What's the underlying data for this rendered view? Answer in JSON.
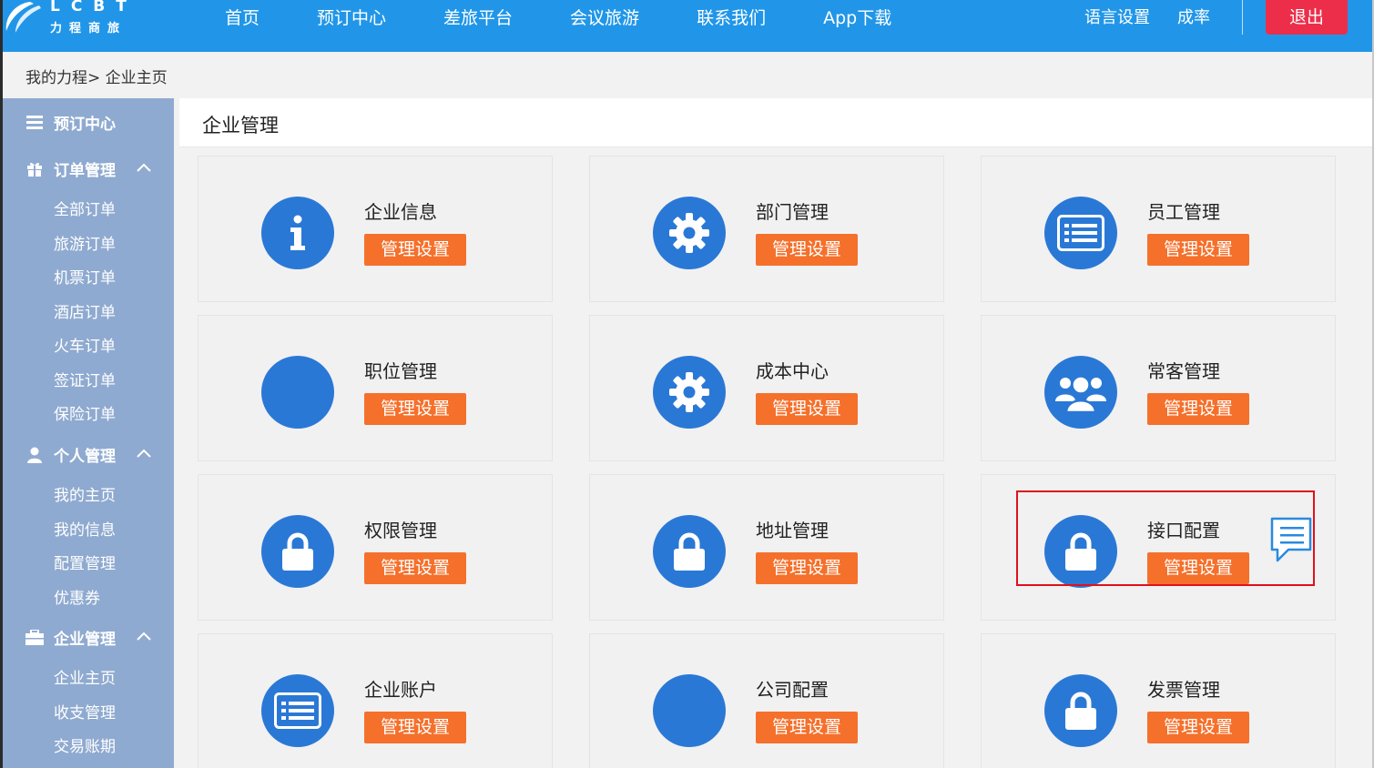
{
  "logo": {
    "en": "LCBT",
    "cn": "力程商旅"
  },
  "nav": {
    "items": [
      "首页",
      "预订中心",
      "差旅平台",
      "会议旅游",
      "联系我们",
      "App下载"
    ],
    "language": "语言设置",
    "user": "成率",
    "logout": "退出"
  },
  "breadcrumb": "我的力程> 企业主页",
  "sidebar": {
    "booking": {
      "label": "预订中心",
      "icon": "list-icon"
    },
    "orders": {
      "label": "订单管理",
      "icon": "gift-icon",
      "items": [
        "全部订单",
        "旅游订单",
        "机票订单",
        "酒店订单",
        "火车订单",
        "签证订单",
        "保险订单"
      ]
    },
    "personal": {
      "label": "个人管理",
      "icon": "user-icon",
      "items": [
        "我的主页",
        "我的信息",
        "配置管理",
        "优惠券"
      ]
    },
    "enterprise": {
      "label": "企业管理",
      "icon": "briefcase-icon",
      "items": [
        "企业主页",
        "收支管理",
        "交易账期"
      ]
    }
  },
  "main": {
    "title": "企业管理",
    "button_label": "管理设置",
    "cards": [
      {
        "title": "企业信息",
        "icon": "info-icon"
      },
      {
        "title": "部门管理",
        "icon": "gear-icon"
      },
      {
        "title": "员工管理",
        "icon": "list-card-icon"
      },
      {
        "title": "职位管理",
        "icon": "blank-circle-icon"
      },
      {
        "title": "成本中心",
        "icon": "gear-icon"
      },
      {
        "title": "常客管理",
        "icon": "users-icon"
      },
      {
        "title": "权限管理",
        "icon": "lock-icon"
      },
      {
        "title": "地址管理",
        "icon": "lock-icon"
      },
      {
        "title": "接口配置",
        "icon": "lock-icon"
      },
      {
        "title": "企业账户",
        "icon": "list-card-icon"
      },
      {
        "title": "公司配置",
        "icon": "blank-circle-icon"
      },
      {
        "title": "发票管理",
        "icon": "lock-icon"
      }
    ]
  },
  "colors": {
    "topbar": "#2196e8",
    "logout": "#ec2e4a",
    "sidebar": "#8faad0",
    "icon_circle": "#2a78d6",
    "button": "#f5702b",
    "highlight": "#e0101d"
  }
}
